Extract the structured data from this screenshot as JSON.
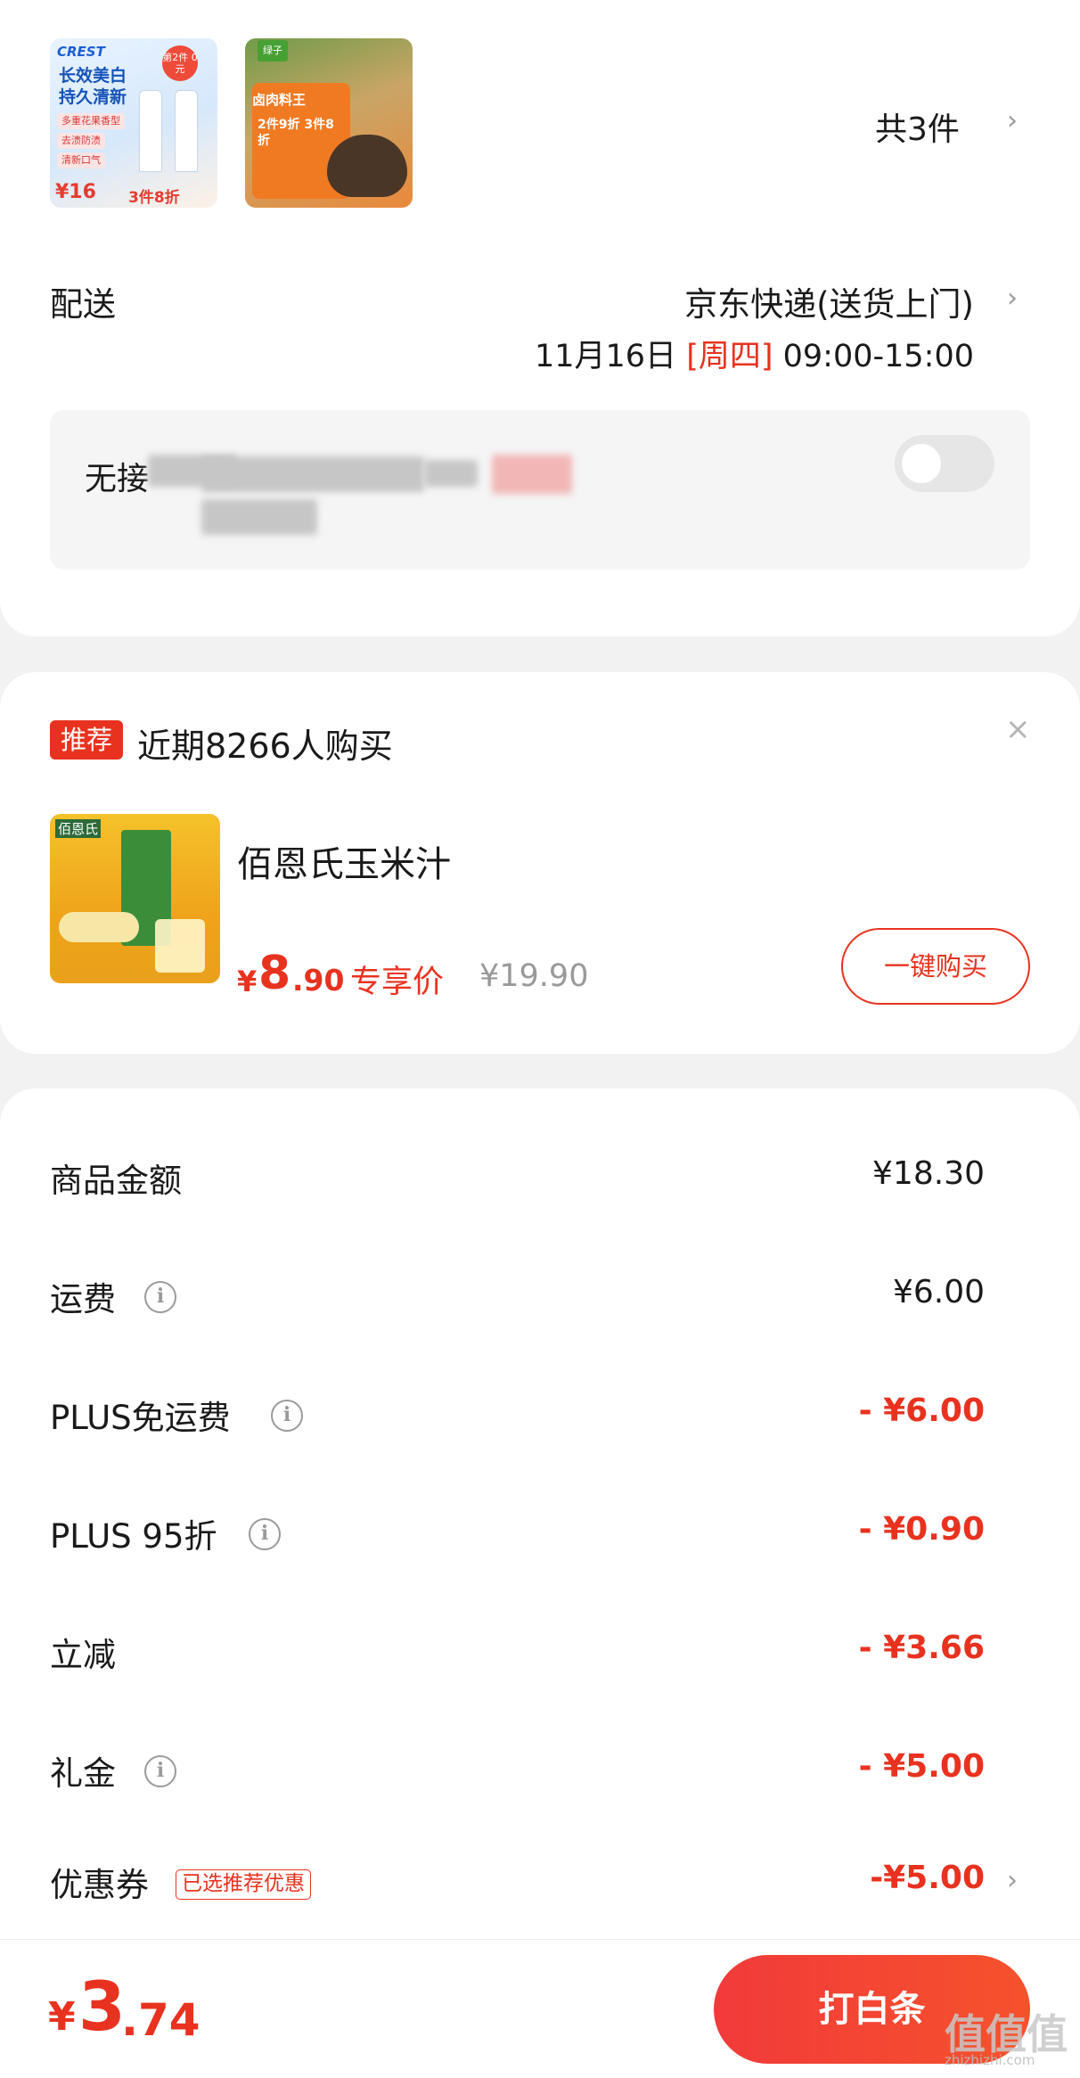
{
  "order": {
    "items_count_label": "共3件",
    "thumb1": {
      "brand": "CREST",
      "badge": "第2件 0元",
      "title_line1": "长效美白",
      "title_line2": "持久清新",
      "bullets": [
        "多重花果香型",
        "去渍防渍",
        "清新口气"
      ],
      "price": "¥16",
      "deal": "3件8折"
    },
    "thumb2": {
      "logo": "绿子",
      "pack_title": "卤肉料王",
      "promo": "2件9折 3件8折"
    }
  },
  "delivery": {
    "label": "配送",
    "method": "京东快递(送货上门)",
    "date": "11月16日",
    "weekday": "[周四]",
    "time": "09:00-15:00"
  },
  "contact": {
    "label": "无接"
  },
  "recommend": {
    "tag": "推荐",
    "title": "近期8266人购买",
    "close": "×",
    "product": {
      "name": "佰恩氏玉米汁",
      "brand_on_image": "佰恩氏",
      "price_symbol": "¥",
      "price_int": "8",
      "price_dec": ".90",
      "exclusive_label": "专享价",
      "original_price": "¥19.90",
      "buy_label": "一键购买"
    }
  },
  "fees": [
    {
      "label": "商品金额",
      "value": "¥18.30"
    },
    {
      "label": "运费",
      "value": "¥6.00"
    },
    {
      "label": "PLUS免运费",
      "value": "- ¥6.00"
    },
    {
      "label": "PLUS 95折",
      "value": "- ¥0.90"
    },
    {
      "label": "立减",
      "value": "- ¥3.66"
    },
    {
      "label": "礼金",
      "value": "- ¥5.00"
    },
    {
      "label": "优惠券",
      "value": "-¥5.00",
      "tag": "已选推荐优惠"
    }
  ],
  "footer": {
    "total_symbol": "¥",
    "total_int": "3",
    "total_dec": ".74",
    "pay_label": "打白条",
    "watermark": "值值值",
    "watermark_sub": "zhizhizhi.com"
  },
  "icons": {
    "chevron": "›",
    "info": "i"
  },
  "colors": {
    "accent_red": "#e8321f",
    "muted_gray": "#999999",
    "page_bg": "#f2f2f2"
  }
}
